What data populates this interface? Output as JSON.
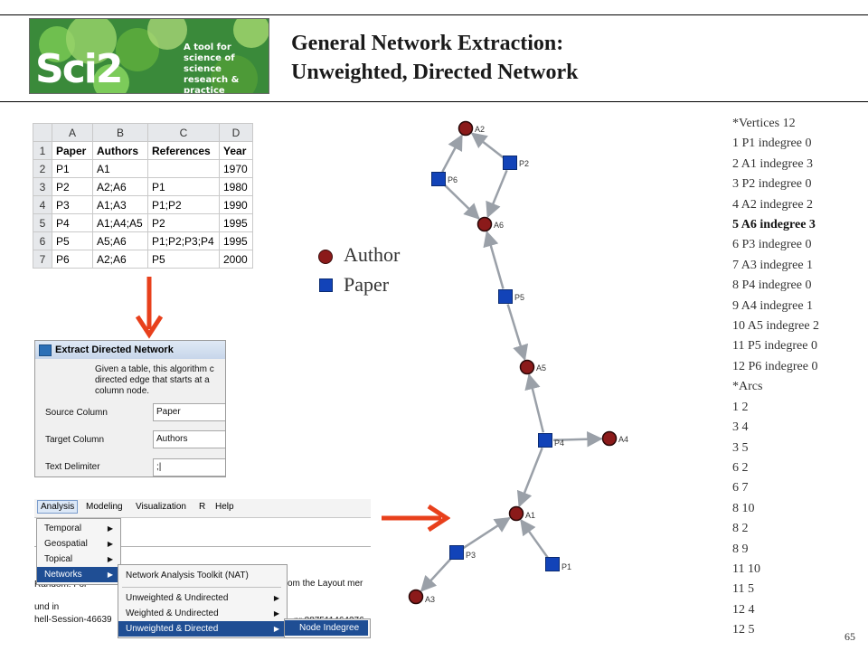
{
  "header": {
    "logo_text": "Sci2",
    "logo_tagline": "A tool for science of science research & practice",
    "title_line1": "General Network Extraction:",
    "title_line2": "Unweighted, Directed Network"
  },
  "spreadsheet": {
    "columns": [
      "A",
      "B",
      "C",
      "D"
    ],
    "rows": [
      {
        "n": "1",
        "cells": [
          "Paper",
          "Authors",
          "References",
          "Year"
        ]
      },
      {
        "n": "2",
        "cells": [
          "P1",
          "A1",
          "",
          "1970"
        ]
      },
      {
        "n": "3",
        "cells": [
          "P2",
          "A2;A6",
          "P1",
          "1980"
        ]
      },
      {
        "n": "4",
        "cells": [
          "P3",
          "A1;A3",
          "P1;P2",
          "1990"
        ]
      },
      {
        "n": "5",
        "cells": [
          "P4",
          "A1;A4;A5",
          "P2",
          "1995"
        ]
      },
      {
        "n": "6",
        "cells": [
          "P5",
          "A5;A6",
          "P1;P2;P3;P4",
          "1995"
        ]
      },
      {
        "n": "7",
        "cells": [
          "P6",
          "A2;A6",
          "P5",
          "2000"
        ]
      }
    ]
  },
  "dialog": {
    "title": "Extract Directed Network",
    "description": "Given a table, this algorithm c directed edge that starts at a column node.",
    "desc_lines": [
      "Given a table, this algorithm c",
      "directed edge that starts at a",
      "column node."
    ],
    "source_label": "Source Column",
    "source_value": "Paper",
    "target_label": "Target Column",
    "target_value": "Authors",
    "delimiter_label": "Text Delimiter",
    "delimiter_value": ";|"
  },
  "menu": {
    "bar": [
      "Analysis",
      "Modeling",
      "Visualization",
      "R",
      "Help"
    ],
    "analysis_items": [
      "Temporal",
      "Geospatial",
      "Topical",
      "Networks"
    ],
    "networks_items": [
      "Network Analysis Toolkit (NAT)",
      "Unweighted & Undirected",
      "Weighted & Undirected",
      "Unweighted & Directed"
    ],
    "directed_items": [
      "Node Indegree"
    ],
    "background_fragments": [
      "om the Layout mer",
      "Random: For a co",
      "nr 887511464276",
      "und in",
      "hell-Session-46639"
    ]
  },
  "legend": {
    "author": "Author",
    "paper": "Paper",
    "author_color": "#8b1a1a",
    "paper_color": "#1243b8"
  },
  "graph": {
    "nodes": [
      {
        "id": "A2",
        "kind": "author"
      },
      {
        "id": "P2",
        "kind": "paper"
      },
      {
        "id": "P6",
        "kind": "paper"
      },
      {
        "id": "A6",
        "kind": "author"
      },
      {
        "id": "P5",
        "kind": "paper"
      },
      {
        "id": "A5",
        "kind": "author"
      },
      {
        "id": "P4",
        "kind": "paper"
      },
      {
        "id": "A4",
        "kind": "author"
      },
      {
        "id": "A1",
        "kind": "author"
      },
      {
        "id": "P3",
        "kind": "paper"
      },
      {
        "id": "P1",
        "kind": "paper"
      },
      {
        "id": "A3",
        "kind": "author"
      }
    ],
    "edges": [
      [
        "P2",
        "A2"
      ],
      [
        "P2",
        "A6"
      ],
      [
        "P6",
        "A2"
      ],
      [
        "P6",
        "A6"
      ],
      [
        "P5",
        "A6"
      ],
      [
        "P5",
        "A5"
      ],
      [
        "P4",
        "A5"
      ],
      [
        "P4",
        "A4"
      ],
      [
        "P4",
        "A1"
      ],
      [
        "P1",
        "A1"
      ],
      [
        "P3",
        "A1"
      ],
      [
        "P3",
        "A3"
      ]
    ]
  },
  "pajek": {
    "lines": [
      "*Vertices 12",
      "1 P1 indegree 0",
      "2 A1 indegree 3",
      "3 P2 indegree 0",
      "4 A2 indegree 2",
      "5 A6 indegree 3",
      "6 P3 indegree 0",
      "7 A3 indegree 1",
      "8 P4 indegree 0",
      "9 A4 indegree 1",
      "10 A5 indegree 2",
      "11 P5 indegree 0",
      "12 P6 indegree 0",
      "*Arcs",
      "1 2",
      "3 4",
      "3 5",
      "6 2",
      "6 7",
      "8 10",
      "8 2",
      "8 9",
      "11 10",
      "11 5",
      "12 4",
      "12 5"
    ],
    "highlight_index": 5
  },
  "page_number": "65",
  "accent_color": "#e8401c"
}
